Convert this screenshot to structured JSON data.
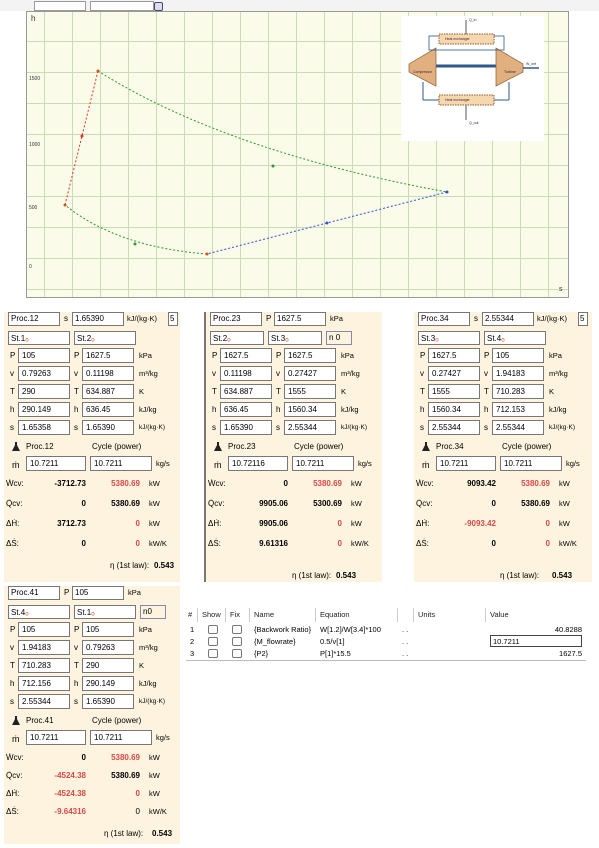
{
  "plot": {
    "y_tick_labels": [
      "1500",
      "1000",
      "500",
      "0"
    ],
    "x_axis_end_label": "s",
    "y_axis_label": "h"
  },
  "inset": {
    "labels": [
      "Compressor",
      "Turbine",
      "Heat exchanger",
      "Heat exchanger",
      "Q_in",
      "Q_out",
      "W_net"
    ]
  },
  "panel12": {
    "proc": "Proc.12",
    "s_label": "s",
    "s_value": "1.65390",
    "s_unit": "kJ/(kg·K)",
    "s_sel": "5",
    "st_a": "St.1",
    "st_b": "St.2",
    "rows": [
      {
        "sym": "P",
        "a": "105",
        "b": "1627.5",
        "unit": "kPa"
      },
      {
        "sym": "v",
        "a": "0.79263",
        "b": "0.11198",
        "unit": "m³/kg"
      },
      {
        "sym": "T",
        "a": "290",
        "b": "634.887",
        "unit": "K"
      },
      {
        "sym": "h",
        "a": "290.149",
        "b": "636.45",
        "unit": "kJ/kg"
      },
      {
        "sym": "s",
        "a": "1.65358",
        "b": "1.65390",
        "unit": "kJ/(kg·K)"
      }
    ],
    "flow_proc": "Proc.12",
    "flow_cycle": "Cycle (power)",
    "mdot_a": "10.7211",
    "mdot_b": "10.7211",
    "mdot_unit": "kg/s",
    "results": [
      {
        "sym": "Ẇcv:",
        "a": "-3712.73",
        "b": "5380.69",
        "unit": "kW"
      },
      {
        "sym": "Q̇cv:",
        "a": "0",
        "b": "5380.69",
        "unit": "kW"
      },
      {
        "sym": "ΔḢ:",
        "a": "3712.73",
        "b": "0",
        "unit": "kW"
      },
      {
        "sym": "ΔṠ:",
        "a": "0",
        "b": "0",
        "unit": "kW/K"
      }
    ],
    "eta_label": "η (1st law):",
    "eta_value": "0.543"
  },
  "panel23": {
    "proc": "Proc.23",
    "p_label": "P",
    "p_value": "1627.5",
    "p_unit": "kPa",
    "st_a": "St.2",
    "st_b": "St.3",
    "n_label": "n",
    "n_value": "0",
    "rows": [
      {
        "sym": "P",
        "a": "1627.5",
        "b": "1627.5",
        "unit": "kPa"
      },
      {
        "sym": "v",
        "a": "0.11198",
        "b": "0.27427",
        "unit": "m³/kg"
      },
      {
        "sym": "T",
        "a": "634.887",
        "b": "1555",
        "unit": "K"
      },
      {
        "sym": "h",
        "a": "636.45",
        "b": "1560.34",
        "unit": "kJ/kg"
      },
      {
        "sym": "s",
        "a": "1.65390",
        "b": "2.55344",
        "unit": "kJ/(kg·K)"
      }
    ],
    "flow_proc": "Proc.23",
    "flow_cycle": "Cycle (power)",
    "mdot_a": "10.72116",
    "mdot_b": "10.7211",
    "mdot_unit": "kg/s",
    "results": [
      {
        "sym": "Ẇcv:",
        "a": "0",
        "b": "5380.69",
        "unit": "kW"
      },
      {
        "sym": "Q̇cv:",
        "a": "9905.06",
        "b": "5300.69",
        "unit": "kW"
      },
      {
        "sym": "ΔḢ:",
        "a": "9905.06",
        "b": "0",
        "unit": "kW"
      },
      {
        "sym": "ΔṠ:",
        "a": "9.61316",
        "b": "0",
        "unit": "kW/K"
      }
    ],
    "eta_label": "η (1st law):",
    "eta_value": "0.543"
  },
  "panel34": {
    "proc": "Proc.34",
    "s_label": "s",
    "s_value": "2.55344",
    "s_unit": "kJ/(kg·K)",
    "s_sel": "5",
    "st_a": "St.3",
    "st_b": "St.4",
    "rows": [
      {
        "sym": "P",
        "a": "1627.5",
        "b": "105",
        "unit": "kPa"
      },
      {
        "sym": "v",
        "a": "0.27427",
        "b": "1.94183",
        "unit": "m³/kg"
      },
      {
        "sym": "T",
        "a": "1555",
        "b": "710.283",
        "unit": "K"
      },
      {
        "sym": "h",
        "a": "1560.34",
        "b": "712.153",
        "unit": "kJ/kg"
      },
      {
        "sym": "s",
        "a": "2.55344",
        "b": "2.55344",
        "unit": "kJ/(kg·K)"
      }
    ],
    "flow_proc": "Proc.34",
    "flow_cycle": "Cycle (power)",
    "mdot_a": "10.7211",
    "mdot_b": "10.7211",
    "mdot_unit": "kg/s",
    "results": [
      {
        "sym": "Ẇcv:",
        "a": "9093.42",
        "b": "5380.69",
        "unit": "kW"
      },
      {
        "sym": "Q̇cv:",
        "a": "0",
        "b": "5380.69",
        "unit": "kW"
      },
      {
        "sym": "ΔḢ:",
        "a": "-9093.42",
        "b": "0",
        "unit": "kW"
      },
      {
        "sym": "ΔṠ:",
        "a": "0",
        "b": "0",
        "unit": "kW/K"
      }
    ],
    "eta_label": "η (1st law):",
    "eta_value": "0.543"
  },
  "panel41": {
    "proc": "Proc.41",
    "p_label": "P",
    "p_value": "105",
    "p_unit": "kPa",
    "st_a": "St.4",
    "st_b": "St.1",
    "n_label": "n",
    "n_value": "0",
    "rows": [
      {
        "sym": "P",
        "a": "105",
        "b": "105",
        "unit": "kPa"
      },
      {
        "sym": "v",
        "a": "1.94183",
        "b": "0.79263",
        "unit": "m³/kg"
      },
      {
        "sym": "T",
        "a": "710.283",
        "b": "290",
        "unit": "K"
      },
      {
        "sym": "h",
        "a": "712.156",
        "b": "290.149",
        "unit": "kJ/kg"
      },
      {
        "sym": "s",
        "a": "2.55344",
        "b": "1.65390",
        "unit": "kJ/(kg·K)"
      }
    ],
    "flow_proc": "Proc.41",
    "flow_cycle": "Cycle (power)",
    "mdot_a": "10.7211",
    "mdot_b": "10.7211",
    "mdot_unit": "kg/s",
    "results": [
      {
        "sym": "Ẇcv:",
        "a": "0",
        "b": "5380.69",
        "unit": "kW"
      },
      {
        "sym": "Q̇cv:",
        "a": "-4524.38",
        "b": "5380.69",
        "unit": "kW"
      },
      {
        "sym": "ΔḢ:",
        "a": "-4524.38",
        "b": "0",
        "unit": "kW"
      },
      {
        "sym": "ΔṠ:",
        "a": "-9.64316",
        "b": "0",
        "unit": "kW/K"
      }
    ],
    "eta_label": "η (1st law):",
    "eta_value": "0.543"
  },
  "table": {
    "headers": [
      "#",
      "Show",
      "Fix",
      "Name",
      "Equation",
      "",
      "Units",
      "Value"
    ],
    "rows": [
      {
        "num": "1",
        "name": "{Backwork Ratio}",
        "equation": "W[1.2]/W[3.4]*100",
        "dots": ". .",
        "units": "",
        "value": "40.8288"
      },
      {
        "num": "2",
        "name": "{M_flowrate}",
        "equation": "0.5/v[1]",
        "dots": ". .",
        "units": "",
        "value": "10.7211"
      },
      {
        "num": "3",
        "name": "{P2}",
        "equation": "P[1]*15.5",
        "dots": ". .",
        "units": "",
        "value": "1627.5"
      }
    ]
  },
  "colors": {
    "panel_bg": "#fdf3de",
    "plot_bg": "#fafbe9",
    "state_dot": "#d3531e",
    "neg_red": "#d84a4a"
  }
}
